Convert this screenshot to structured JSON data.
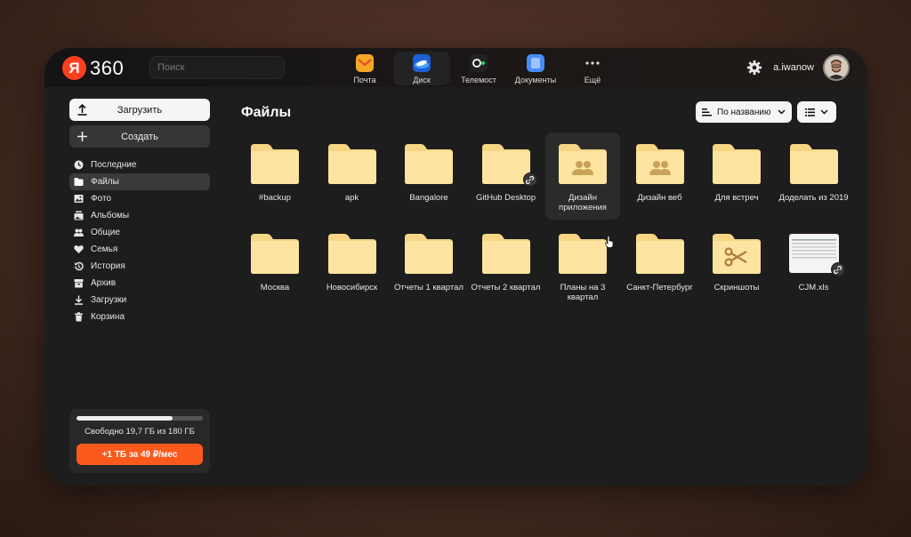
{
  "header": {
    "logo_letter": "Я",
    "logo_text": "360",
    "search_placeholder": "Поиск",
    "apps": [
      {
        "label": "Почта",
        "icon": "mail-icon",
        "color": "#f5a623",
        "active": false
      },
      {
        "label": "Диск",
        "icon": "disk-icon",
        "color": "#1a73e8",
        "active": true
      },
      {
        "label": "Телемост",
        "icon": "telemost-icon",
        "color": "#2b2b2b",
        "active": false
      },
      {
        "label": "Документы",
        "icon": "documents-icon",
        "color": "#4a8cf7",
        "active": false
      },
      {
        "label": "Ещё",
        "icon": "more-icon",
        "color": "",
        "active": false
      }
    ],
    "username": "a.iwanow"
  },
  "sidebar": {
    "upload_label": "Загрузить",
    "create_label": "Создать",
    "items": [
      {
        "label": "Последние",
        "icon": "clock-icon",
        "active": false
      },
      {
        "label": "Файлы",
        "icon": "folder-icon",
        "active": true
      },
      {
        "label": "Фото",
        "icon": "photo-icon",
        "active": false
      },
      {
        "label": "Альбомы",
        "icon": "albums-icon",
        "active": false
      },
      {
        "label": "Общие",
        "icon": "shared-icon",
        "active": false
      },
      {
        "label": "Семья",
        "icon": "heart-icon",
        "active": false
      },
      {
        "label": "История",
        "icon": "history-icon",
        "active": false
      },
      {
        "label": "Архив",
        "icon": "archive-icon",
        "active": false
      },
      {
        "label": "Загрузки",
        "icon": "download-icon",
        "active": false
      },
      {
        "label": "Корзина",
        "icon": "trash-icon",
        "active": false
      }
    ],
    "storage": {
      "used_fraction": 0.76,
      "text": "Свободно 19,7 ГБ из 180 ГБ",
      "buy_label": "+1 ТБ за 49 ₽/мес"
    }
  },
  "main": {
    "title": "Файлы",
    "sort_label": "По названию",
    "items": [
      {
        "name": "#backup",
        "type": "folder"
      },
      {
        "name": "apk",
        "type": "folder"
      },
      {
        "name": "Bangalore",
        "type": "folder"
      },
      {
        "name": "GitHub Desktop",
        "type": "folder",
        "badge": "link-icon"
      },
      {
        "name": "Дизайн приложения",
        "type": "shared-folder",
        "hover": true
      },
      {
        "name": "Дизайн веб",
        "type": "shared-folder"
      },
      {
        "name": "Для встреч",
        "type": "folder"
      },
      {
        "name": "Доделать из 2019",
        "type": "folder"
      },
      {
        "name": "Москва",
        "type": "folder"
      },
      {
        "name": "Новосибирск",
        "type": "folder"
      },
      {
        "name": "Отчеты 1 квартал",
        "type": "folder"
      },
      {
        "name": "Отчеты 2 квартал",
        "type": "folder"
      },
      {
        "name": "Планы на 3 квартал",
        "type": "folder"
      },
      {
        "name": "Санкт-Петербург",
        "type": "folder"
      },
      {
        "name": "Скриншоты",
        "type": "screenshots-folder"
      },
      {
        "name": "CJM.xls",
        "type": "xls",
        "badge": "link-icon"
      }
    ]
  },
  "colors": {
    "folder": "#fde4a0",
    "folder_tab": "#f6d684",
    "accent": "#fc5a1d",
    "logo": "#fc3f1d"
  }
}
